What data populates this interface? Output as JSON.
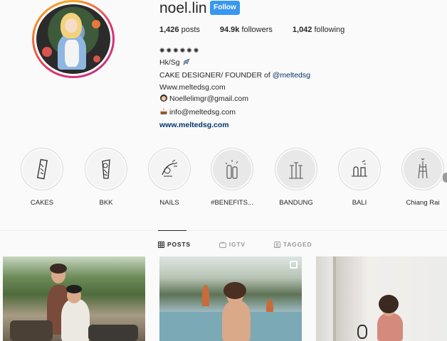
{
  "profile": {
    "username": "noel.lin",
    "follow_label": "Follow",
    "stats": {
      "posts_count": "1,426",
      "posts_label": "posts",
      "followers_count": "94.9k",
      "followers_label": "followers",
      "following_count": "1,042",
      "following_label": "following"
    },
    "bio": {
      "dots": "✺✺✺✺✺✺",
      "location": "Hk/Sg",
      "role_prefix": "CAKE DESIGNER/ FOUNDER of ",
      "role_mention": "@meltedsg",
      "website_text": "Www.meltedsg.com",
      "email_1": "Noellelimgr@gmail.com",
      "email_2": "info@meltedsg.com",
      "link": "www.meltedsg.com"
    }
  },
  "highlights": [
    {
      "label": "CAKES",
      "icon": "cake-sketch-icon"
    },
    {
      "label": "BKK",
      "icon": "bkk-sketch-icon"
    },
    {
      "label": "NAILS",
      "icon": "nails-sketch-icon"
    },
    {
      "label": "#BENEFITS...",
      "icon": "benefits-sketch-icon"
    },
    {
      "label": "BANDUNG",
      "icon": "bandung-sketch-icon"
    },
    {
      "label": "BALI",
      "icon": "bali-sketch-icon"
    },
    {
      "label": "Chiang Rai",
      "icon": "chiang-rai-sketch-icon"
    }
  ],
  "tabs": [
    {
      "label": "POSTS",
      "icon": "grid-icon",
      "active": true
    },
    {
      "label": "IGTV",
      "icon": "tv-icon",
      "active": false
    },
    {
      "label": "TAGGED",
      "icon": "tag-icon",
      "active": false
    }
  ],
  "colors": {
    "follow_button": "#3897f0",
    "link": "#003569",
    "text": "#262626",
    "muted": "#999999"
  }
}
